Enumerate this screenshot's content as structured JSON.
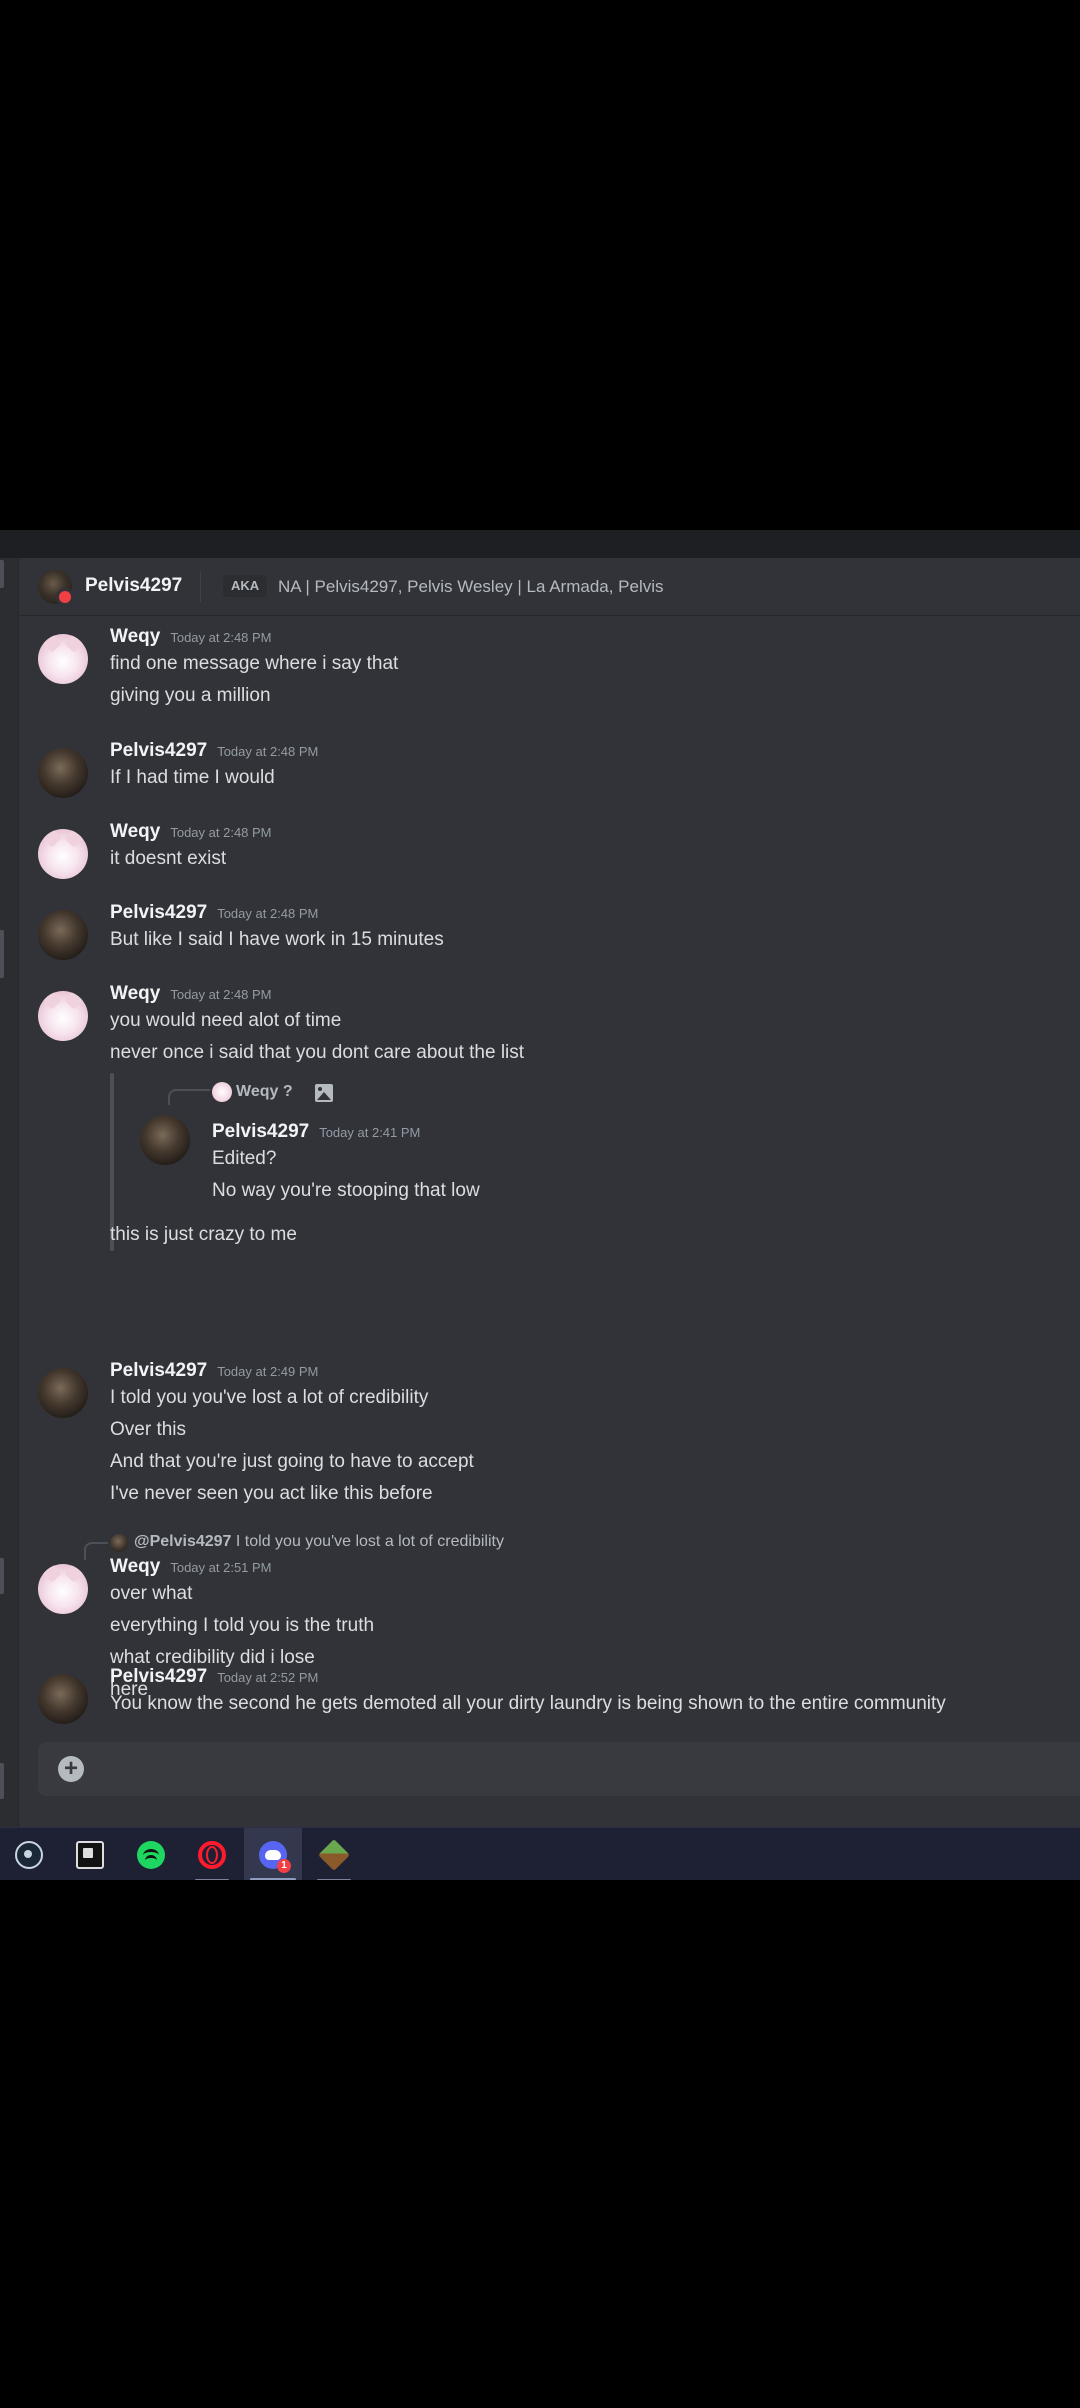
{
  "channel_header": {
    "name": "Pelvis4297",
    "aka_label": "AKA",
    "aka_names": "NA | Pelvis4297, Pelvis Wesley | La Armada, Pelvis"
  },
  "messages": [
    {
      "author": "Weqy",
      "time": "Today at 2:48 PM",
      "lines": [
        "find one message where i say that",
        "giving you a million"
      ]
    },
    {
      "author": "Pelvis4297",
      "time": "Today at 2:48 PM",
      "lines": [
        "If I had time I would"
      ]
    },
    {
      "author": "Weqy",
      "time": "Today at 2:48 PM",
      "lines": [
        "it doesnt exist"
      ]
    },
    {
      "author": "Pelvis4297",
      "time": "Today at 2:48 PM",
      "lines": [
        "But like I said I have work in 15 minutes"
      ]
    },
    {
      "author": "Weqy",
      "time": "Today at 2:48 PM",
      "lines": [
        "you would need alot of time",
        "never once i said that you dont care about the list"
      ],
      "embed": {
        "ref_author": "Weqy",
        "ref_suffix": "?",
        "author": "Pelvis4297",
        "time": "Today at 2:41 PM",
        "lines": [
          "Edited?",
          "No way you're stooping that low"
        ]
      },
      "after_lines": [
        "this is just crazy to me"
      ]
    },
    {
      "author": "Pelvis4297",
      "time": "Today at 2:49 PM",
      "lines": [
        "I told you you've lost a lot of credibility",
        "Over this",
        "And that you're just going to have to accept",
        "I've never seen you act like this before"
      ]
    },
    {
      "reply_to": {
        "mention": "@Pelvis4297",
        "text": "I told you you've lost a lot of credibility"
      },
      "author": "Weqy",
      "time": "Today at 2:51 PM",
      "lines": [
        "over what",
        "everything I told you is the truth",
        "what credibility did i lose",
        "here"
      ]
    },
    {
      "author": "Pelvis4297",
      "time": "Today at 2:52 PM",
      "lines": [
        "You know the second he gets demoted all your dirty laundry is being shown to the entire community"
      ]
    }
  ],
  "composer": {
    "add_icon": "plus-circle-icon"
  },
  "taskbar": {
    "apps": [
      {
        "name": "steam-icon"
      },
      {
        "name": "epic-games-icon"
      },
      {
        "name": "spotify-icon"
      },
      {
        "name": "opera-gx-icon"
      },
      {
        "name": "discord-icon",
        "badge": "1"
      },
      {
        "name": "minecraft-icon"
      }
    ]
  },
  "colors": {
    "background": "#313338",
    "text": "#dbdee1",
    "muted": "#949ba4",
    "dnd": "#f23f43",
    "taskbar": "#1e2134"
  }
}
